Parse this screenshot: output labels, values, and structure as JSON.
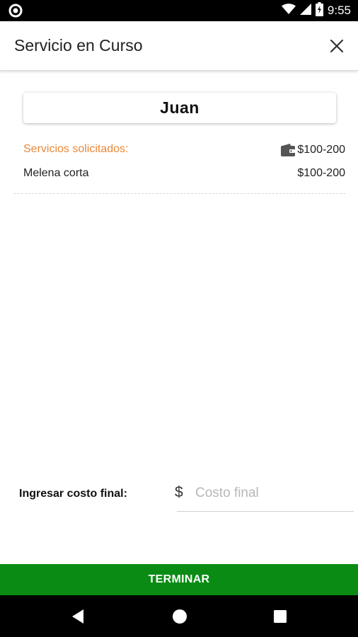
{
  "status_bar": {
    "time": "9:55",
    "icons": [
      "circle-notification-icon",
      "wifi-icon",
      "signal-icon",
      "battery-icon"
    ]
  },
  "app_bar": {
    "title": "Servicio en Curso",
    "close_icon": "close-icon"
  },
  "client": {
    "name": "Juan"
  },
  "services": {
    "label": "Servicios solicitados:",
    "total": "$100-200",
    "total_icon": "wallet-icon",
    "items": [
      {
        "name": "Melena corta",
        "price": "$100-200"
      }
    ]
  },
  "final_cost": {
    "label": "Ingresar costo final:",
    "currency_symbol": "$",
    "placeholder": "Costo final",
    "value": ""
  },
  "finish_button": {
    "label": "TERMINAR"
  },
  "nav_bar": {
    "icons": [
      "back-icon",
      "home-icon",
      "recents-icon"
    ]
  },
  "colors": {
    "accent_orange": "#e8883a",
    "finish_green": "#0a8c14",
    "status_bar": "#000000"
  }
}
